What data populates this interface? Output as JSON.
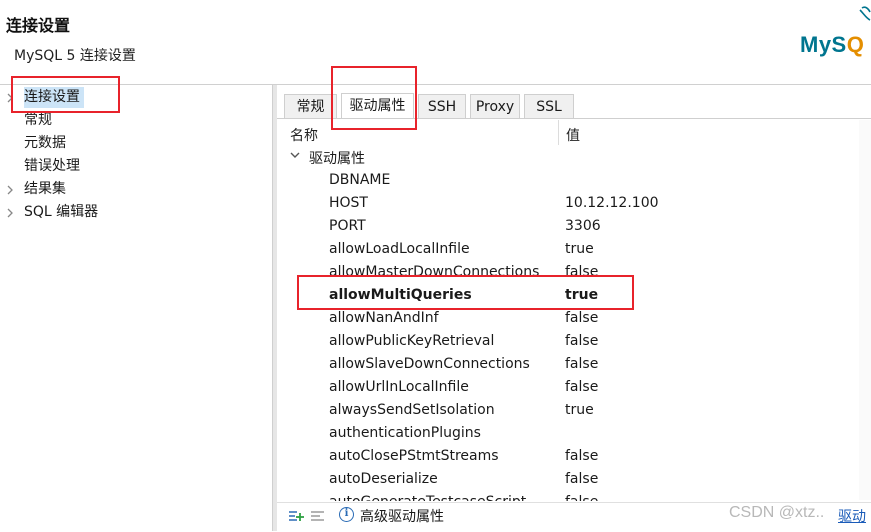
{
  "header": {
    "title": "连接设置",
    "subtitle": "MySQL 5 连接设置",
    "logo": {
      "text_main": "MyS",
      "text_accent": "Q",
      "brand_color": "#00758f",
      "accent_color": "#e48e00"
    }
  },
  "sidebar": {
    "items": [
      {
        "label": "连接设置",
        "selected": true,
        "expandable": true
      },
      {
        "label": "常规",
        "selected": false,
        "expandable": false
      },
      {
        "label": "元数据",
        "selected": false,
        "expandable": false
      },
      {
        "label": "错误处理",
        "selected": false,
        "expandable": false
      },
      {
        "label": "结果集",
        "selected": false,
        "expandable": true
      },
      {
        "label": "SQL 编辑器",
        "selected": false,
        "expandable": true
      }
    ]
  },
  "tabs": [
    {
      "label": "常规",
      "active": false
    },
    {
      "label": "驱动属性",
      "active": true
    },
    {
      "label": "SSH",
      "active": false
    },
    {
      "label": "Proxy",
      "active": false
    },
    {
      "label": "SSL",
      "active": false
    }
  ],
  "table": {
    "columns": {
      "name": "名称",
      "value": "值"
    },
    "group_label": "驱动属性",
    "rows": [
      {
        "name": "DBNAME",
        "value": ""
      },
      {
        "name": "HOST",
        "value": "10.12.12.100"
      },
      {
        "name": "PORT",
        "value": "3306"
      },
      {
        "name": "allowLoadLocalInfile",
        "value": "true"
      },
      {
        "name": "allowMasterDownConnections",
        "value": "false"
      },
      {
        "name": "allowMultiQueries",
        "value": "true",
        "highlighted": true
      },
      {
        "name": "allowNanAndInf",
        "value": "false"
      },
      {
        "name": "allowPublicKeyRetrieval",
        "value": "false"
      },
      {
        "name": "allowSlaveDownConnections",
        "value": "false"
      },
      {
        "name": "allowUrlInLocalInfile",
        "value": "false"
      },
      {
        "name": "alwaysSendSetIsolation",
        "value": "true"
      },
      {
        "name": "authenticationPlugins",
        "value": ""
      },
      {
        "name": "autoClosePStmtStreams",
        "value": "false"
      },
      {
        "name": "autoDeserialize",
        "value": "false"
      },
      {
        "name": "autoGenerateTestcaseScript",
        "value": "false"
      }
    ]
  },
  "footer": {
    "advanced_label": "高级驱动属性",
    "watermark": "CSDN @xtz..",
    "link_text": "驱动"
  },
  "colors": {
    "annotation": "#e8232b",
    "selection": "#cce4f7",
    "link": "#1a5bb8"
  }
}
